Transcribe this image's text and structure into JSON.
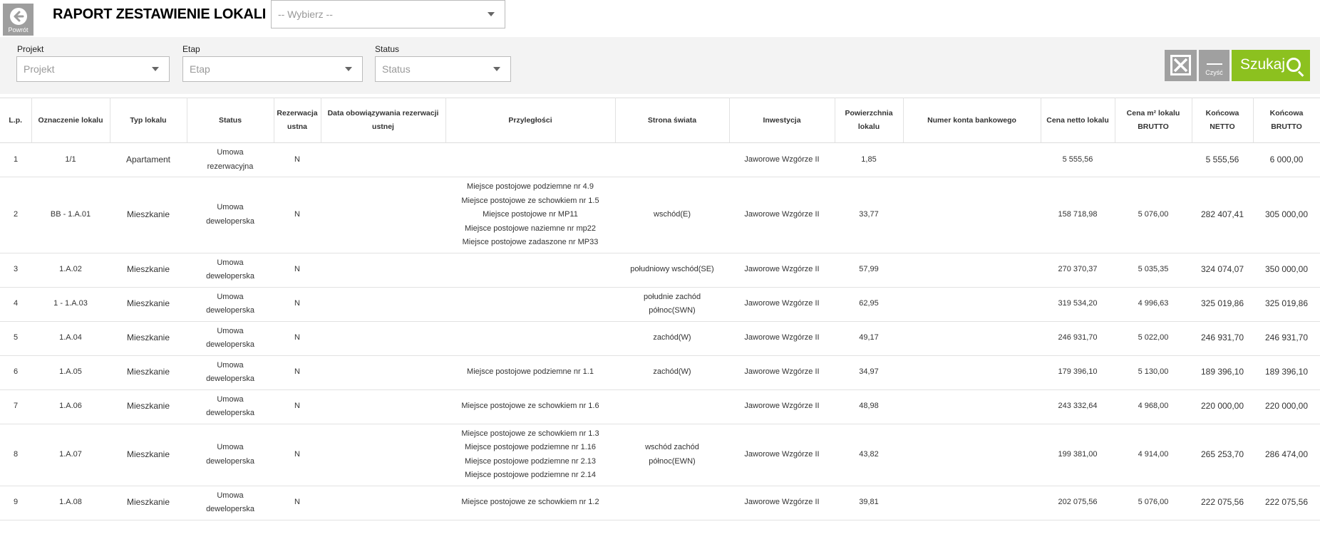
{
  "header": {
    "back_label": "Powrót",
    "title": "RAPORT ZESTAWIENIE LOKALI",
    "select_placeholder": "-- Wybierz --"
  },
  "filters": {
    "projekt_label": "Projekt",
    "projekt_placeholder": "Projekt",
    "etap_label": "Etap",
    "etap_placeholder": "Etap",
    "status_label": "Status",
    "status_placeholder": "Status"
  },
  "actions": {
    "clear_label": "Czyść",
    "search_label": "Szukaj",
    "export_icon": "excel-icon",
    "search_icon": "magnifier-icon"
  },
  "colors": {
    "accent_green": "#8cc11f",
    "button_gray": "#a0a0a0",
    "panel_bg": "#f3f3f3"
  },
  "table": {
    "headers": [
      "L.p.",
      "Oznaczenie lokalu",
      "Typ lokalu",
      "Status",
      "Rezerwacja ustna",
      "Data obowiązywania rezerwacji ustnej",
      "Przyległości",
      "Strona świata",
      "Inwestycja",
      "Powierzchnia lokalu",
      "Numer konta bankowego",
      "Cena netto lokalu",
      "Cena m² lokalu BRUTTO",
      "Końcowa NETTO",
      "Końcowa BRUTTO"
    ],
    "rows": [
      {
        "lp": "1",
        "oznaczenie": "1/1",
        "typ": "Apartament",
        "status": [
          "Umowa",
          "rezerwacyjna"
        ],
        "rezerwacja": "N",
        "data_rez": "",
        "przyleglosci": [],
        "strona": [],
        "inwestycja": "Jaworowe Wzgórze II",
        "powierzchnia": "1,85",
        "konto": "",
        "cena_netto": "5 555,56",
        "cena_m2": "",
        "koncowa_netto": "5 555,56",
        "koncowa_brutto": "6 000,00"
      },
      {
        "lp": "2",
        "oznaczenie": "BB - 1.A.01",
        "typ": "Mieszkanie",
        "status": [
          "Umowa",
          "deweloperska"
        ],
        "rezerwacja": "N",
        "data_rez": "",
        "przyleglosci": [
          "Miejsce postojowe podziemne nr 4.9",
          "Miejsce postojowe ze schowkiem nr 1.5",
          "Miejsce postojowe nr MP11",
          "Miejsce postojowe naziemne nr mp22",
          "Miejsce postojowe zadaszone nr MP33"
        ],
        "strona": [
          "wschód(E)"
        ],
        "inwestycja": "Jaworowe Wzgórze II",
        "powierzchnia": "33,77",
        "konto": "",
        "cena_netto": "158 718,98",
        "cena_m2": "5 076,00",
        "koncowa_netto": "282 407,41",
        "koncowa_brutto": "305 000,00"
      },
      {
        "lp": "3",
        "oznaczenie": "1.A.02",
        "typ": "Mieszkanie",
        "status": [
          "Umowa",
          "deweloperska"
        ],
        "rezerwacja": "N",
        "data_rez": "",
        "przyleglosci": [],
        "strona": [
          "południowy wschód(SE)"
        ],
        "inwestycja": "Jaworowe Wzgórze II",
        "powierzchnia": "57,99",
        "konto": "",
        "cena_netto": "270 370,37",
        "cena_m2": "5 035,35",
        "koncowa_netto": "324 074,07",
        "koncowa_brutto": "350 000,00"
      },
      {
        "lp": "4",
        "oznaczenie": "1 - 1.A.03",
        "typ": "Mieszkanie",
        "status": [
          "Umowa",
          "deweloperska"
        ],
        "rezerwacja": "N",
        "data_rez": "",
        "przyleglosci": [],
        "strona": [
          "południe zachód",
          "północ(SWN)"
        ],
        "inwestycja": "Jaworowe Wzgórze II",
        "powierzchnia": "62,95",
        "konto": "",
        "cena_netto": "319 534,20",
        "cena_m2": "4 996,63",
        "koncowa_netto": "325 019,86",
        "koncowa_brutto": "325 019,86"
      },
      {
        "lp": "5",
        "oznaczenie": "1.A.04",
        "typ": "Mieszkanie",
        "status": [
          "Umowa",
          "deweloperska"
        ],
        "rezerwacja": "N",
        "data_rez": "",
        "przyleglosci": [],
        "strona": [
          "zachód(W)"
        ],
        "inwestycja": "Jaworowe Wzgórze II",
        "powierzchnia": "49,17",
        "konto": "",
        "cena_netto": "246 931,70",
        "cena_m2": "5 022,00",
        "koncowa_netto": "246 931,70",
        "koncowa_brutto": "246 931,70"
      },
      {
        "lp": "6",
        "oznaczenie": "1.A.05",
        "typ": "Mieszkanie",
        "status": [
          "Umowa",
          "deweloperska"
        ],
        "rezerwacja": "N",
        "data_rez": "",
        "przyleglosci": [
          "Miejsce postojowe podziemne nr 1.1"
        ],
        "strona": [
          "zachód(W)"
        ],
        "inwestycja": "Jaworowe Wzgórze II",
        "powierzchnia": "34,97",
        "konto": "",
        "cena_netto": "179 396,10",
        "cena_m2": "5 130,00",
        "koncowa_netto": "189 396,10",
        "koncowa_brutto": "189 396,10"
      },
      {
        "lp": "7",
        "oznaczenie": "1.A.06",
        "typ": "Mieszkanie",
        "status": [
          "Umowa",
          "deweloperska"
        ],
        "rezerwacja": "N",
        "data_rez": "",
        "przyleglosci": [
          "Miejsce postojowe ze schowkiem nr 1.6"
        ],
        "strona": [],
        "inwestycja": "Jaworowe Wzgórze II",
        "powierzchnia": "48,98",
        "konto": "",
        "cena_netto": "243 332,64",
        "cena_m2": "4 968,00",
        "koncowa_netto": "220 000,00",
        "koncowa_brutto": "220 000,00"
      },
      {
        "lp": "8",
        "oznaczenie": "1.A.07",
        "typ": "Mieszkanie",
        "status": [
          "Umowa",
          "deweloperska"
        ],
        "rezerwacja": "N",
        "data_rez": "",
        "przyleglosci": [
          "Miejsce postojowe ze schowkiem nr 1.3",
          "Miejsce postojowe podziemne nr 1.16",
          "Miejsce postojowe podziemne nr 2.13",
          "Miejsce postojowe podziemne nr 2.14"
        ],
        "strona": [
          "wschód zachód",
          "północ(EWN)"
        ],
        "inwestycja": "Jaworowe Wzgórze II",
        "powierzchnia": "43,82",
        "konto": "",
        "cena_netto": "199 381,00",
        "cena_m2": "4 914,00",
        "koncowa_netto": "265 253,70",
        "koncowa_brutto": "286 474,00"
      },
      {
        "lp": "9",
        "oznaczenie": "1.A.08",
        "typ": "Mieszkanie",
        "status": [
          "Umowa",
          "deweloperska"
        ],
        "rezerwacja": "N",
        "data_rez": "",
        "przyleglosci": [
          "Miejsce postojowe ze schowkiem nr 1.2"
        ],
        "strona": [],
        "inwestycja": "Jaworowe Wzgórze II",
        "powierzchnia": "39,81",
        "konto": "",
        "cena_netto": "202 075,56",
        "cena_m2": "5 076,00",
        "koncowa_netto": "222 075,56",
        "koncowa_brutto": "222 075,56"
      }
    ]
  }
}
